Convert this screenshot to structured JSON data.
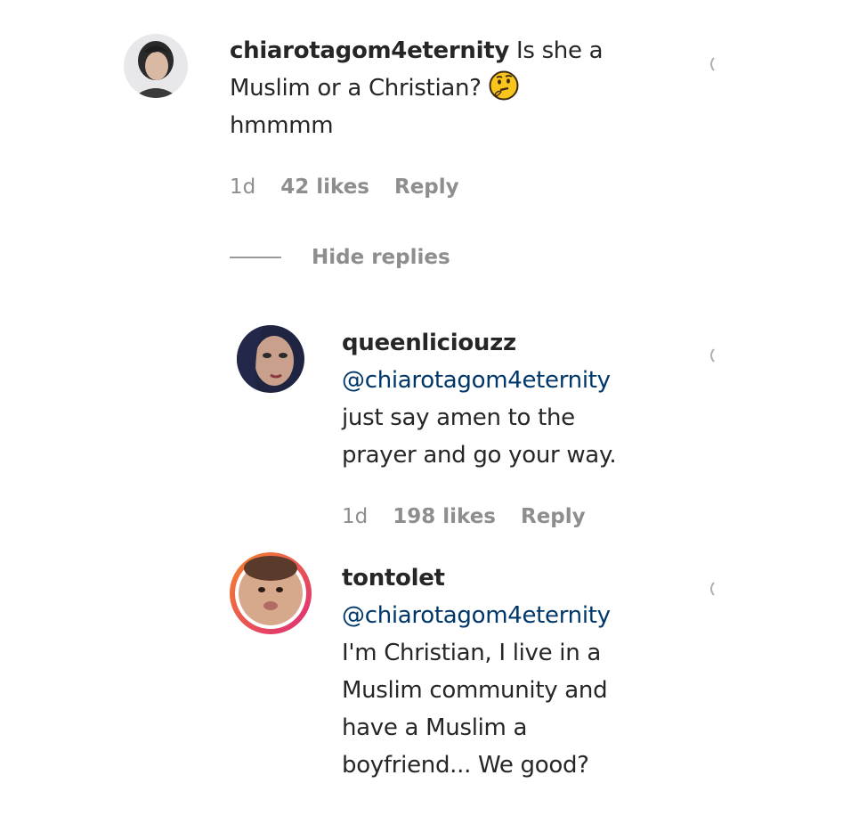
{
  "comments": [
    {
      "username": "chiarotagom4eternity",
      "text_line1": "Is she a",
      "text_line2": "Muslim or a Christian?",
      "emoji": "thinking-face-emoji",
      "text_line3": "hmmmm",
      "time": "1d",
      "likes": "42 likes",
      "reply": "Reply"
    }
  ],
  "hide_replies_label": "Hide replies",
  "replies": [
    {
      "username": "queenliciouzz",
      "mention": "@chiarotagom4eternity",
      "text_lines": [
        "just say amen to the",
        "prayer and go your way."
      ],
      "time": "1d",
      "likes": "198 likes",
      "reply": "Reply"
    },
    {
      "username": "tontolet",
      "mention": "@chiarotagom4eternity",
      "text_lines": [
        "I'm Christian, I live in a",
        "Muslim community and",
        "have a Muslim a",
        "boyfriend... We good?"
      ]
    }
  ],
  "colors": {
    "text": "#262626",
    "mention": "#00376b",
    "meta": "#8e8e8e",
    "story_ring_start": "#f58529",
    "story_ring_end": "#dd2a7b"
  },
  "icons": [
    "heart-icon",
    "avatar",
    "thinking-face-emoji"
  ]
}
